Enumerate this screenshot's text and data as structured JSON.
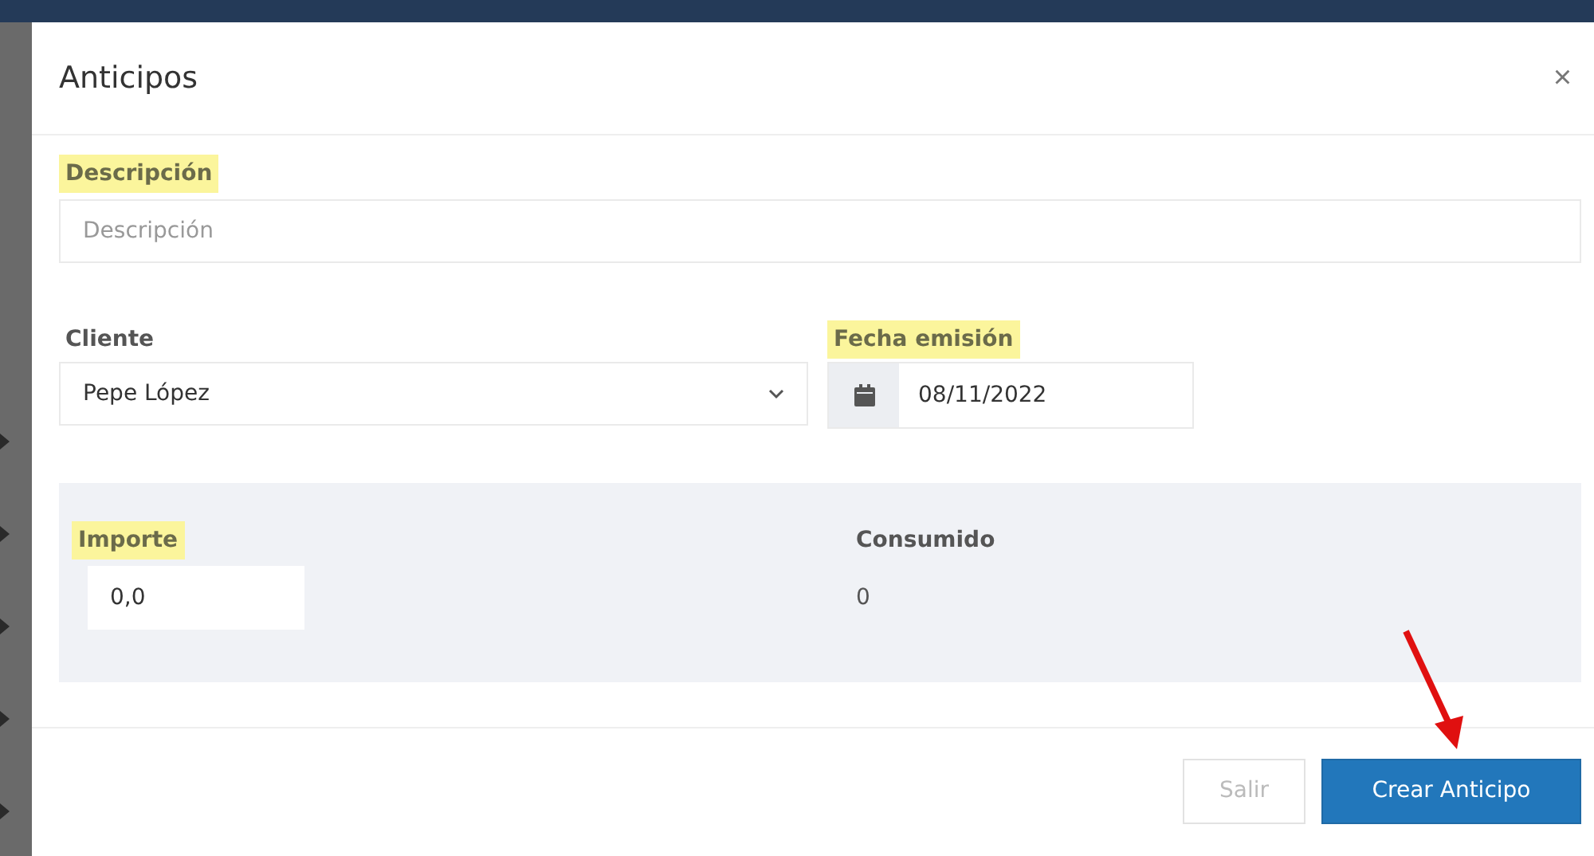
{
  "dialog": {
    "title": "Anticipos",
    "close": "×"
  },
  "description": {
    "label": "Descripción",
    "highlighted": true,
    "placeholder": "Descripción"
  },
  "client": {
    "label": "Cliente",
    "highlighted": false,
    "value": "Pepe López"
  },
  "issue_date": {
    "label": "Fecha emisión",
    "highlighted": true,
    "value": "08/11/2022"
  },
  "amounts": [
    {
      "kind": "input",
      "label": "Importe",
      "highlighted": true,
      "value": "0,0"
    },
    {
      "kind": "text",
      "label": "Consumido",
      "highlighted": false,
      "value": "0"
    }
  ],
  "buttons": [
    {
      "label": "Salir",
      "primary": false,
      "disabled": true
    },
    {
      "label": "Crear Anticipo",
      "primary": true,
      "disabled": false
    }
  ]
}
